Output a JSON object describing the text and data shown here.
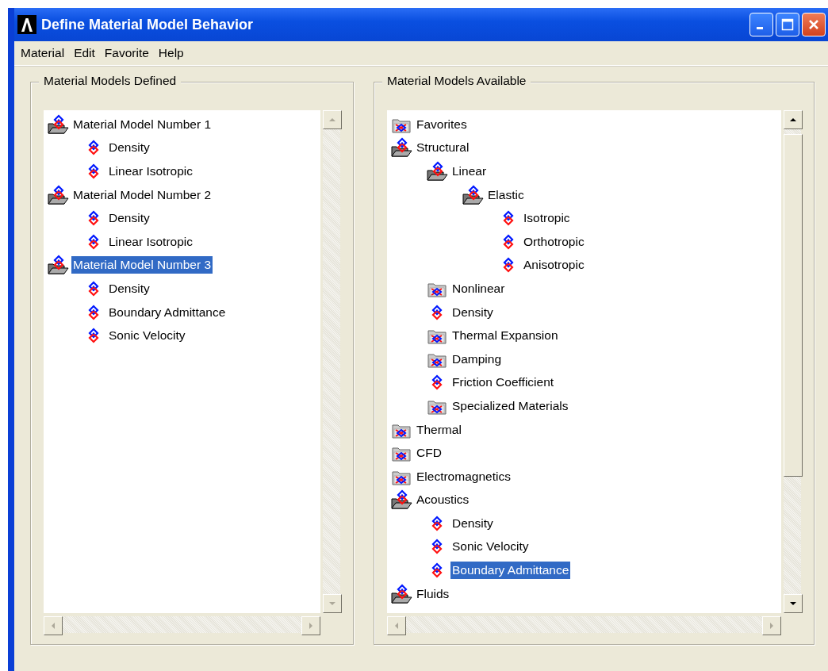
{
  "window": {
    "title": "Define Material Model Behavior"
  },
  "menu": [
    "Material",
    "Edit",
    "Favorite",
    "Help"
  ],
  "defined": {
    "title": "Material Models Defined",
    "tree": [
      {
        "kind": "folder",
        "label": "Material Model Number 1",
        "expanded": true,
        "selected": false,
        "children": [
          {
            "kind": "leaf",
            "label": "Density",
            "selected": false
          },
          {
            "kind": "leaf",
            "label": "Linear Isotropic",
            "selected": false
          }
        ]
      },
      {
        "kind": "folder",
        "label": "Material Model Number 2",
        "expanded": true,
        "selected": false,
        "children": [
          {
            "kind": "leaf",
            "label": "Density",
            "selected": false
          },
          {
            "kind": "leaf",
            "label": "Linear Isotropic",
            "selected": false
          }
        ]
      },
      {
        "kind": "folder",
        "label": "Material Model Number 3",
        "expanded": true,
        "selected": true,
        "children": [
          {
            "kind": "leaf",
            "label": "Density",
            "selected": false
          },
          {
            "kind": "leaf",
            "label": "Boundary Admittance",
            "selected": false
          },
          {
            "kind": "leaf",
            "label": "Sonic Velocity",
            "selected": false
          }
        ]
      }
    ]
  },
  "available": {
    "title": "Material Models Available",
    "tree": [
      {
        "kind": "folder",
        "label": "Favorites",
        "expanded": false,
        "selected": false
      },
      {
        "kind": "folder",
        "label": "Structural",
        "expanded": true,
        "selected": false,
        "children": [
          {
            "kind": "folder",
            "label": "Linear",
            "expanded": true,
            "selected": false,
            "children": [
              {
                "kind": "folder",
                "label": "Elastic",
                "expanded": true,
                "selected": false,
                "children": [
                  {
                    "kind": "leaf",
                    "label": "Isotropic",
                    "selected": false
                  },
                  {
                    "kind": "leaf",
                    "label": "Orthotropic",
                    "selected": false
                  },
                  {
                    "kind": "leaf",
                    "label": "Anisotropic",
                    "selected": false
                  }
                ]
              }
            ]
          },
          {
            "kind": "folder",
            "label": "Nonlinear",
            "expanded": false,
            "selected": false
          },
          {
            "kind": "leaf",
            "label": "Density",
            "selected": false
          },
          {
            "kind": "folder",
            "label": "Thermal Expansion",
            "expanded": false,
            "selected": false
          },
          {
            "kind": "folder",
            "label": "Damping",
            "expanded": false,
            "selected": false
          },
          {
            "kind": "leaf",
            "label": "Friction Coefficient",
            "selected": false
          },
          {
            "kind": "folder",
            "label": "Specialized Materials",
            "expanded": false,
            "selected": false
          }
        ]
      },
      {
        "kind": "folder",
        "label": "Thermal",
        "expanded": false,
        "selected": false
      },
      {
        "kind": "folder",
        "label": "CFD",
        "expanded": false,
        "selected": false
      },
      {
        "kind": "folder",
        "label": "Electromagnetics",
        "expanded": false,
        "selected": false
      },
      {
        "kind": "folder",
        "label": "Acoustics",
        "expanded": true,
        "selected": false,
        "children": [
          {
            "kind": "leaf",
            "label": "Density",
            "selected": false
          },
          {
            "kind": "leaf",
            "label": "Sonic Velocity",
            "selected": false
          },
          {
            "kind": "leaf",
            "label": "Boundary Admittance",
            "selected": true
          }
        ]
      },
      {
        "kind": "folder",
        "label": "Fluids",
        "expanded": true,
        "selected": false
      }
    ]
  }
}
